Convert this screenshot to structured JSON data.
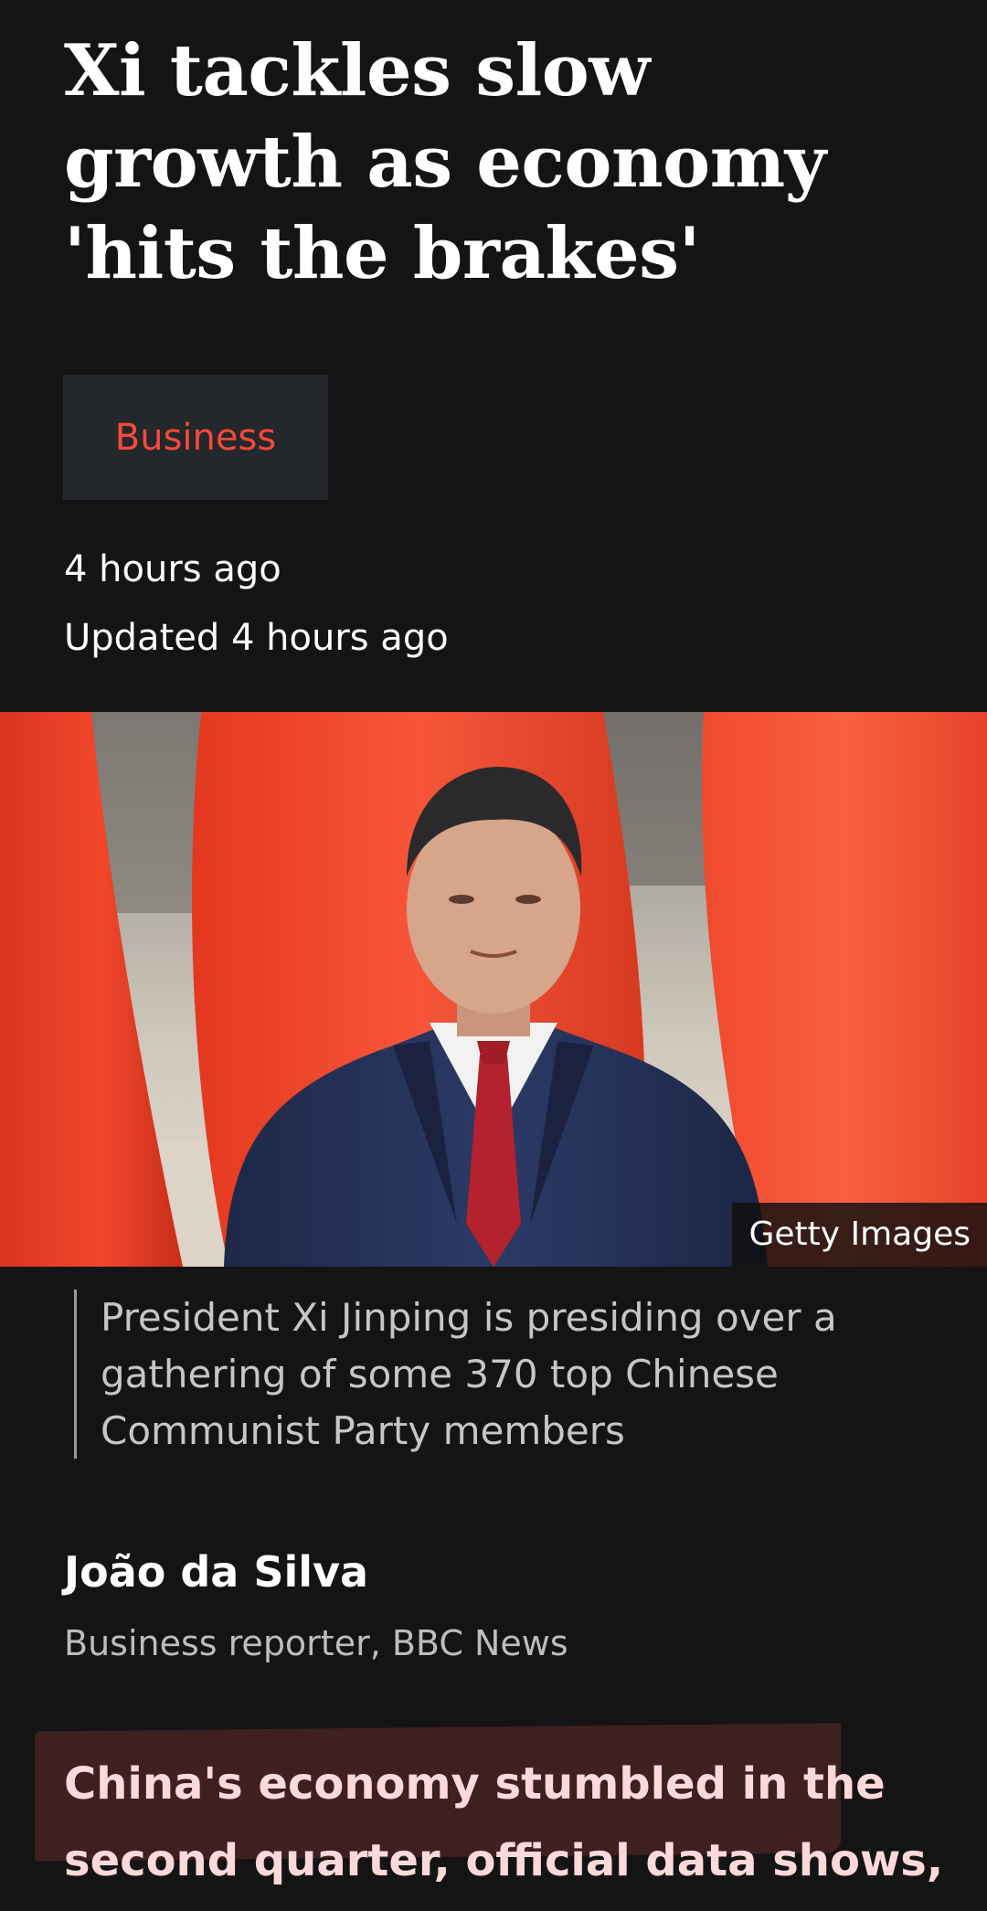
{
  "article": {
    "headline": "Xi tackles slow growth as economy 'hits the brakes'",
    "topic_tag": "Business",
    "published": "4 hours ago",
    "updated": "Updated 4 hours ago",
    "image": {
      "credit": "Getty Images",
      "caption": "President Xi Jinping is presiding over a gathering of some 370 top Chinese Communist Party members"
    },
    "byline": {
      "name": "João da Silva",
      "role": "Business reporter, BBC News"
    },
    "lede": {
      "highlighted": "China's economy stumbled in the second quarter, official data shows,",
      "rest": ""
    }
  },
  "colors": {
    "background": "#141414",
    "topic_tag_text": "#f54a3a",
    "topic_tag_bg": "#24272b",
    "highlight_bg": "#3e2020",
    "highlight_text": "#ffd9da"
  }
}
